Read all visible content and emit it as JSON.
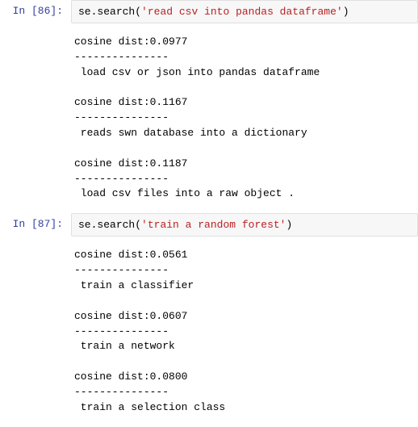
{
  "cells": [
    {
      "prompt_prefix": "In [",
      "prompt_number": "86",
      "prompt_suffix": "]:",
      "code_parts": {
        "obj": "se",
        "dot": ".",
        "method": "search",
        "paren_open": "(",
        "str": "'read csv into pandas dataframe'",
        "paren_close": ")"
      },
      "output": "cosine dist:0.0977\n---------------\n load csv or json into pandas dataframe\n\ncosine dist:0.1167\n---------------\n reads swn database into a dictionary\n\ncosine dist:0.1187\n---------------\n load csv files into a raw object ."
    },
    {
      "prompt_prefix": "In [",
      "prompt_number": "87",
      "prompt_suffix": "]:",
      "code_parts": {
        "obj": "se",
        "dot": ".",
        "method": "search",
        "paren_open": "(",
        "str": "'train a random forest'",
        "paren_close": ")"
      },
      "output": "cosine dist:0.0561\n---------------\n train a classifier\n\ncosine dist:0.0607\n---------------\n train a network\n\ncosine dist:0.0800\n---------------\n train a selection class"
    }
  ]
}
